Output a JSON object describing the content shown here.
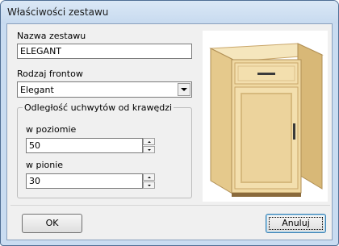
{
  "window": {
    "title": "Właściwości zestawu"
  },
  "form": {
    "set_name_label": "Nazwa zestawu",
    "set_name_value": "ELEGANT",
    "front_type_label": "Rodzaj frontow",
    "front_type_value": "Elegant",
    "handle_group_label": "Odległość uchwytów od krawędzi",
    "horizontal_label": "w poziomie",
    "horizontal_value": "50",
    "vertical_label": "w pionie",
    "vertical_value": "30"
  },
  "preview": {
    "icon": "cabinet-preview-image",
    "colors": {
      "wood_light": "#f3dfae",
      "wood_mid": "#e5c98c",
      "wood_dark": "#c9a66a",
      "handle": "#3a3a3a",
      "base": "#8a6a3c"
    }
  },
  "buttons": {
    "ok_label": "OK",
    "cancel_label": "Anuluj"
  }
}
